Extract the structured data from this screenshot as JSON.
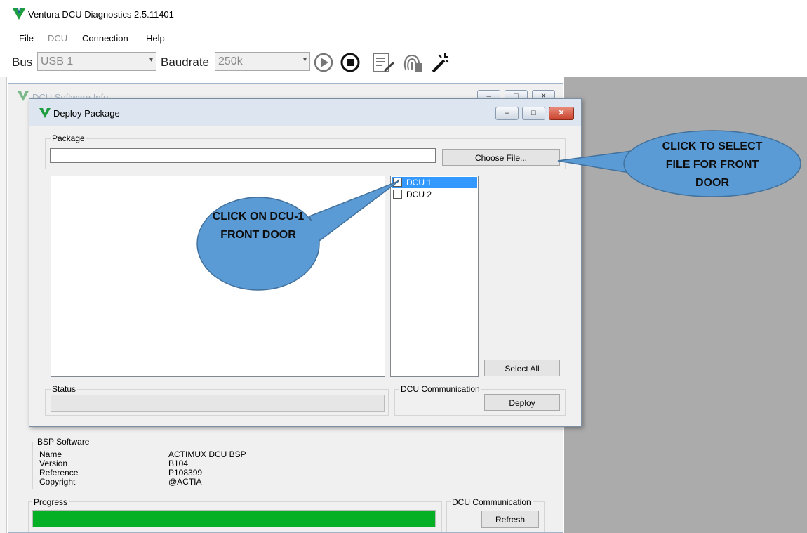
{
  "app": {
    "title": "Ventura DCU Diagnostics 2.5.11401",
    "menu": [
      "File",
      "DCU",
      "Connection",
      "Help"
    ],
    "toolbar": {
      "bus_label": "Bus",
      "bus_value": "USB 1",
      "baudrate_label": "Baudrate",
      "baudrate_value": "250k"
    }
  },
  "background_window": {
    "title": "DCU Software Info",
    "bsp": {
      "legend": "BSP Software",
      "rows": [
        {
          "key": "Name",
          "value": "ACTIMUX DCU BSP"
        },
        {
          "key": "Version",
          "value": "B104"
        },
        {
          "key": "Reference",
          "value": "P108399"
        },
        {
          "key": "Copyright",
          "value": "@ACTIA"
        }
      ]
    },
    "progress": {
      "legend": "Progress",
      "percent": 100
    },
    "dcu_comm": {
      "legend": "DCU Communication",
      "refresh_label": "Refresh"
    }
  },
  "dialog": {
    "title": "Deploy Package",
    "package_legend": "Package",
    "package_path": "",
    "choose_file_label": "Choose File...",
    "dcu_list": [
      {
        "label": "DCU 1",
        "checked": true,
        "selected": true
      },
      {
        "label": "DCU 2",
        "checked": false,
        "selected": false
      }
    ],
    "select_all_label": "Select All",
    "status_legend": "Status",
    "dcu_comm_legend": "DCU Communication",
    "deploy_label": "Deploy"
  },
  "callouts": {
    "dcu1": "CLICK ON DCU-1 FRONT DOOR",
    "choose_file": "CLICK TO SELECT FILE FOR FRONT DOOR"
  },
  "colors": {
    "brand": "#1e9e3e",
    "progress_fill": "#06b025",
    "callout_fill": "#5b9bd5",
    "selection": "#3399ff"
  }
}
